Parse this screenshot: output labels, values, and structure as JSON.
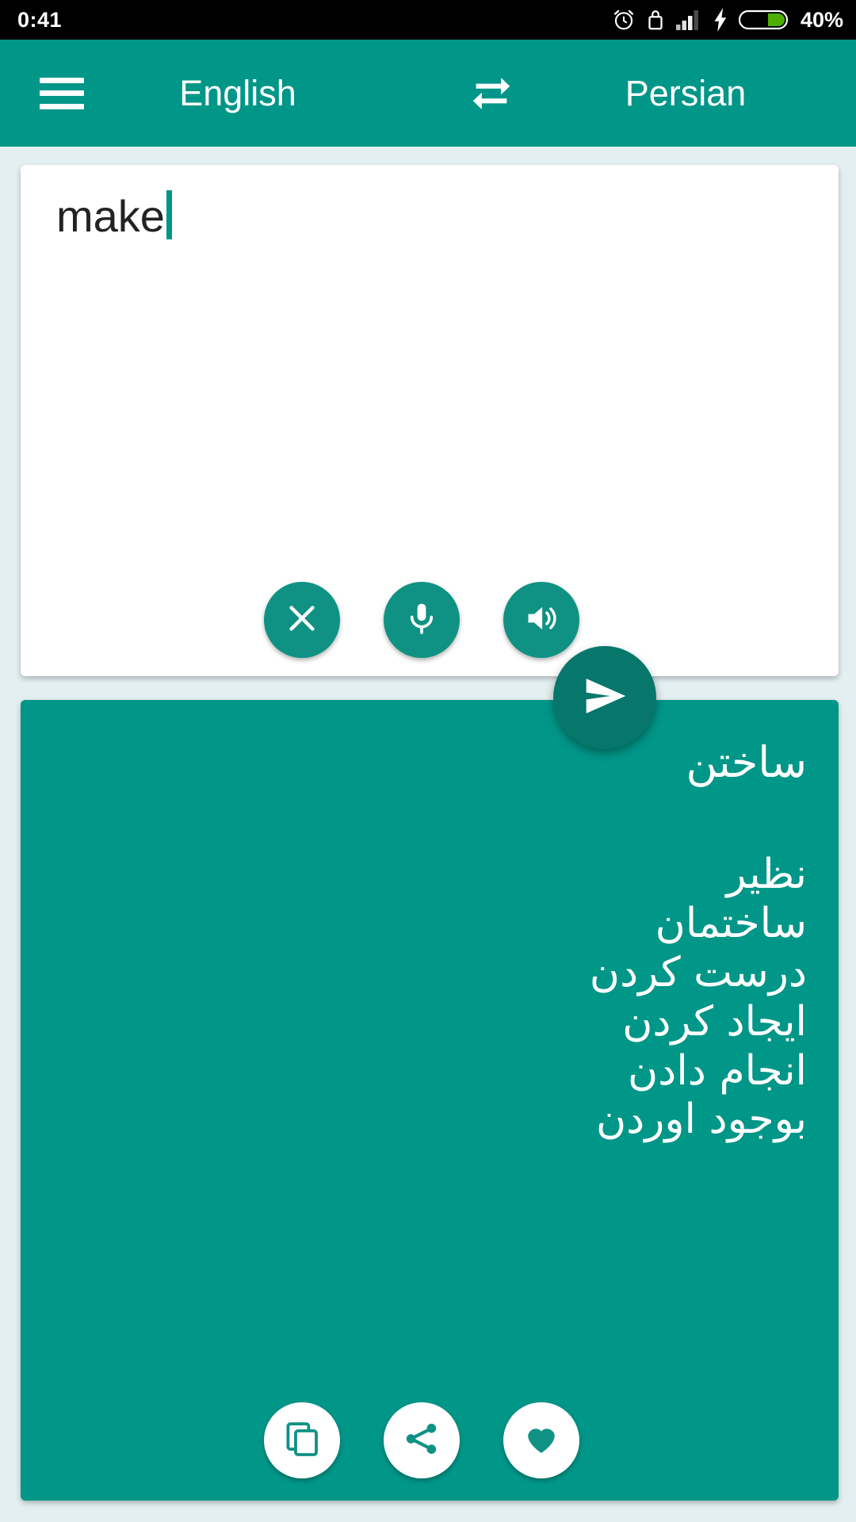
{
  "status_bar": {
    "time": "0:41",
    "battery_percent": "40%",
    "icons": [
      "alarm-icon",
      "lock-icon",
      "signal-icon",
      "charging-bolt-icon",
      "battery-icon"
    ]
  },
  "header": {
    "menu_icon": "hamburger-menu-icon",
    "source_language": "English",
    "swap_icon": "swap-languages-icon",
    "target_language": "Persian"
  },
  "input_card": {
    "text": "make",
    "placeholder": "",
    "actions": [
      {
        "name": "clear-button",
        "icon": "close-icon"
      },
      {
        "name": "voice-input-button",
        "icon": "microphone-icon"
      },
      {
        "name": "speak-source-button",
        "icon": "speaker-icon"
      }
    ]
  },
  "send_button": {
    "icon": "send-icon"
  },
  "output_card": {
    "primary_translation": "ساختن",
    "alternatives": [
      "نظیر",
      "ساختمان",
      "درست کردن",
      "ایجاد کردن",
      "انجام دادن",
      "بوجود اوردن"
    ],
    "actions": [
      {
        "name": "copy-button",
        "icon": "copy-icon"
      },
      {
        "name": "share-button",
        "icon": "share-icon"
      },
      {
        "name": "favorite-button",
        "icon": "heart-icon"
      }
    ]
  },
  "colors": {
    "accent": "#009688",
    "accent_dark": "#07776c",
    "background": "#e3eff0",
    "status_bar": "#000000",
    "battery_fill": "#4caf00"
  }
}
